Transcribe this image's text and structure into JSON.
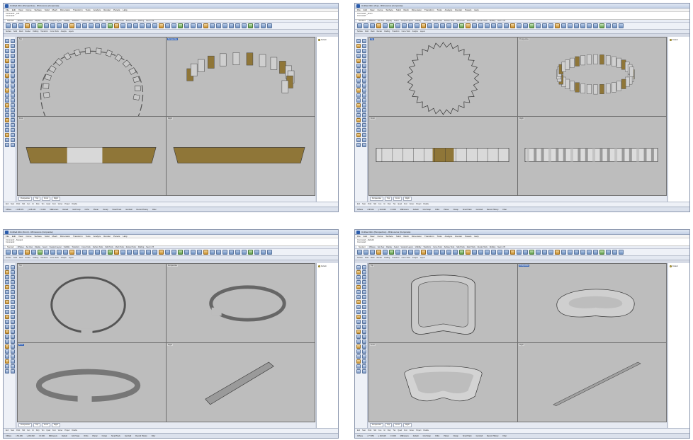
{
  "colors": {
    "viewport_bg": "#bdbdbd",
    "metal": "#a8a8a8",
    "gold": "#8f7638",
    "accent": "#3b67b6"
  },
  "windows": [
    {
      "id": "w1",
      "titlebar": "Untitled.3dm (Perspective) - Rhinoceros (Corporate)",
      "menu": [
        "File",
        "Edit",
        "View",
        "Curve",
        "Surface",
        "Solid",
        "Mesh",
        "Dimension",
        "Transform",
        "Tools",
        "Analyze",
        "Render",
        "Panels",
        "Help"
      ],
      "cmd": [
        "Command: _Loft",
        "Command:"
      ],
      "tabs": [
        "Standard",
        "CPlanes",
        "Set View",
        "Display",
        "Select",
        "Viewport Layout",
        "Visibility",
        "Transform",
        "Curve Tools",
        "Surface Tools",
        "Solid Tools",
        "Mesh Tools",
        "Render Tools",
        "Drafting",
        "New in V5"
      ],
      "subtabs": [
        "Surface",
        "Solid",
        "Mesh",
        "Render",
        "Drafting",
        "Transform",
        "Curve Tools",
        "Analyze",
        "Layers"
      ],
      "viewports": [
        {
          "label": "Top",
          "active": false
        },
        {
          "label": "Perspective",
          "active": true
        },
        {
          "label": "Front",
          "active": false
        },
        {
          "label": "Right",
          "active": false
        }
      ],
      "vptabs": [
        "Perspective",
        "Top",
        "Front",
        "Right"
      ],
      "layer": "Default",
      "snaps": [
        "End",
        "Near",
        "Point",
        "Mid",
        "Cen",
        "Int",
        "Perp",
        "Tan",
        "Quad",
        "Knot",
        "Vertex",
        "Project",
        "Disable"
      ],
      "status": [
        "CPlane",
        "x 146.872",
        "y 215.433",
        "z 0.000",
        "Millimeters",
        "Default",
        "Grid Snap",
        "Ortho",
        "Planar",
        "Osnap",
        "SmartTrack",
        "Gumball",
        "Record History",
        "Filter"
      ]
    },
    {
      "id": "w2",
      "titlebar": "Untitled.3dm (Top) - Rhinoceros (Corporate)",
      "menu": [
        "File",
        "Edit",
        "View",
        "Curve",
        "Surface",
        "Solid",
        "Mesh",
        "Dimension",
        "Transform",
        "Tools",
        "Analyze",
        "Render",
        "Panels",
        "Help"
      ],
      "cmd": [
        "Command: _Zoom",
        "Command:"
      ],
      "tabs": [
        "Standard",
        "CPlanes",
        "Set View",
        "Display",
        "Select",
        "Viewport Layout",
        "Visibility",
        "Transform",
        "Curve Tools",
        "Surface Tools",
        "Solid Tools",
        "Mesh Tools",
        "Render Tools",
        "Drafting",
        "New in V5"
      ],
      "subtabs": [
        "Surface",
        "Solid",
        "Mesh",
        "Render",
        "Drafting",
        "Transform",
        "Curve Tools",
        "Analyze",
        "Layers"
      ],
      "viewports": [
        {
          "label": "Top",
          "active": true
        },
        {
          "label": "Perspective",
          "active": false
        },
        {
          "label": "Front",
          "active": false
        },
        {
          "label": "Right",
          "active": false
        }
      ],
      "vptabs": [
        "Perspective",
        "Top",
        "Front",
        "Right"
      ],
      "layer": "Default",
      "snaps": [
        "End",
        "Near",
        "Point",
        "Mid",
        "Cen",
        "Int",
        "Perp",
        "Tan",
        "Quad",
        "Knot",
        "Vertex",
        "Project",
        "Disable"
      ],
      "status": [
        "CPlane",
        "x 98.114",
        "y 144.026",
        "z 0.000",
        "Millimeters",
        "Default",
        "Grid Snap",
        "Ortho",
        "Planar",
        "Osnap",
        "SmartTrack",
        "Gumball",
        "Record History",
        "Filter"
      ]
    },
    {
      "id": "w3",
      "titlebar": "Untitled.3dm (Front) - Rhinoceros (Corporate)",
      "menu": [
        "File",
        "Edit",
        "View",
        "Curve",
        "Surface",
        "Solid",
        "Mesh",
        "Dimension",
        "Transform",
        "Tools",
        "Analyze",
        "Render",
        "Panels",
        "Help"
      ],
      "cmd": [
        "Command: _Sweep1",
        "Command:"
      ],
      "tabs": [
        "Standard",
        "CPlanes",
        "Set View",
        "Display",
        "Select",
        "Viewport Layout",
        "Visibility",
        "Transform",
        "Curve Tools",
        "Surface Tools",
        "Solid Tools",
        "Mesh Tools",
        "Render Tools",
        "Drafting",
        "New in V5"
      ],
      "subtabs": [
        "Surface",
        "Solid",
        "Mesh",
        "Render",
        "Drafting",
        "Transform",
        "Curve Tools",
        "Analyze",
        "Layers"
      ],
      "viewports": [
        {
          "label": "Top",
          "active": false
        },
        {
          "label": "Perspective",
          "active": false
        },
        {
          "label": "Front",
          "active": true
        },
        {
          "label": "Right",
          "active": false
        }
      ],
      "vptabs": [
        "Perspective",
        "Top",
        "Front",
        "Right"
      ],
      "layer": "Default",
      "snaps": [
        "End",
        "Near",
        "Point",
        "Mid",
        "Cen",
        "Int",
        "Perp",
        "Tan",
        "Quad",
        "Knot",
        "Vertex",
        "Project",
        "Disable"
      ],
      "status": [
        "CPlane",
        "x 52.409",
        "y 181.602",
        "z 0.000",
        "Millimeters",
        "Default",
        "Grid Snap",
        "Ortho",
        "Planar",
        "Osnap",
        "SmartTrack",
        "Gumball",
        "Record History",
        "Filter"
      ]
    },
    {
      "id": "w4",
      "titlebar": "Untitled.3dm (Perspective) - Rhinoceros (Corporate)",
      "menu": [
        "File",
        "Edit",
        "View",
        "Curve",
        "Surface",
        "Solid",
        "Mesh",
        "Dimension",
        "Transform",
        "Tools",
        "Analyze",
        "Render",
        "Panels",
        "Help"
      ],
      "cmd": [
        "Command: _Rebuild",
        "Command:"
      ],
      "tabs": [
        "Standard",
        "CPlanes",
        "Set View",
        "Display",
        "Select",
        "Viewport Layout",
        "Visibility",
        "Transform",
        "Curve Tools",
        "Surface Tools",
        "Solid Tools",
        "Mesh Tools",
        "Render Tools",
        "Drafting",
        "New in V5"
      ],
      "subtabs": [
        "Surface",
        "Solid",
        "Mesh",
        "Render",
        "Drafting",
        "Transform",
        "Curve Tools",
        "Analyze",
        "Layers"
      ],
      "viewports": [
        {
          "label": "Top",
          "active": false
        },
        {
          "label": "Perspective",
          "active": true
        },
        {
          "label": "Front",
          "active": false
        },
        {
          "label": "Right",
          "active": false
        }
      ],
      "vptabs": [
        "Perspective",
        "Top",
        "Front",
        "Right"
      ],
      "layer": "Default",
      "snaps": [
        "End",
        "Near",
        "Point",
        "Mid",
        "Cen",
        "Int",
        "Perp",
        "Tan",
        "Quad",
        "Knot",
        "Vertex",
        "Project",
        "Disable"
      ],
      "status": [
        "CPlane",
        "x 77.350",
        "y 203.118",
        "z 0.000",
        "Millimeters",
        "Default",
        "Grid Snap",
        "Ortho",
        "Planar",
        "Osnap",
        "SmartTrack",
        "Gumball",
        "Record History",
        "Filter"
      ]
    }
  ]
}
